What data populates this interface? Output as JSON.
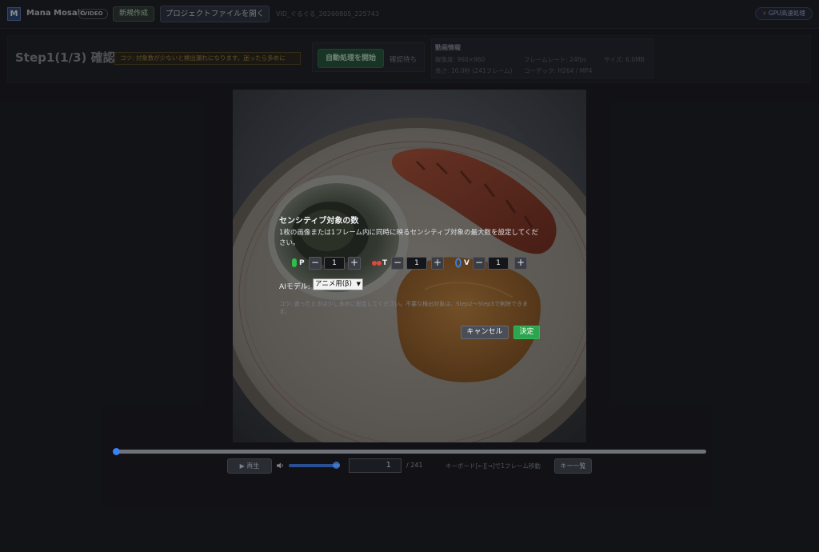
{
  "header": {
    "app_name": "Mana Mosaic",
    "logo_letter": "M",
    "badge": "VIDEO",
    "new_button": "新規作成",
    "open_button": "プロジェクトファイルを開く",
    "filename": "VID_ぐるぐる_20260805_225743",
    "gpu_badge": "GPU高速処理"
  },
  "step": {
    "title": "Step1(1/3) 確認",
    "tip": "コツ: 対象数が少ないと検出漏れになります。迷ったら多めに",
    "auto_button": "自動処理を開始",
    "wait_label": "確認待ち"
  },
  "video_info": {
    "title": "動画情報",
    "resolution": "解像度: 960×960",
    "framerate": "フレームレート: 24fps",
    "size": "サイズ: 6.0MB",
    "length": "長さ: 10.0秒 (241フレーム)",
    "codec": "コーデック: H264 / MP4"
  },
  "dialog": {
    "title": "センシティブ対象の数",
    "description": "1枚の画像または1フレーム内に同時に映るセンシティブ対象の最大数を設定してください。",
    "counters": [
      {
        "label": "P",
        "value": "1",
        "icon": "green-pin-icon",
        "color": "#2fbf4a"
      },
      {
        "label": "T",
        "value": "1",
        "icon": "red-pair-icon",
        "color": "#e0483a"
      },
      {
        "label": "V",
        "value": "1",
        "icon": "blue-ring-icon",
        "color": "#3b7ddd"
      }
    ],
    "minus": "−",
    "plus": "+",
    "model_label": "AIモデル:",
    "model_value": "アニメ用(β)",
    "note": "コツ: 迷ったときは少し多めに設定してください。不要な検出対象は、Step2〜Step3で削除できます。",
    "cancel_button": "キャンセル",
    "ok_button": "決定"
  },
  "player": {
    "play_button": "▶ 再生",
    "current_frame": "1",
    "total_frames": "/ 241",
    "keyboard_hint": "キーボード[←][→]で1フレーム移動",
    "keys_button": "キー一覧",
    "seek_progress": 0.0,
    "volume": 1.0
  },
  "colors": {
    "accent": "#3b82f6",
    "ok": "#2da44e",
    "tip": "#a68a3e"
  }
}
